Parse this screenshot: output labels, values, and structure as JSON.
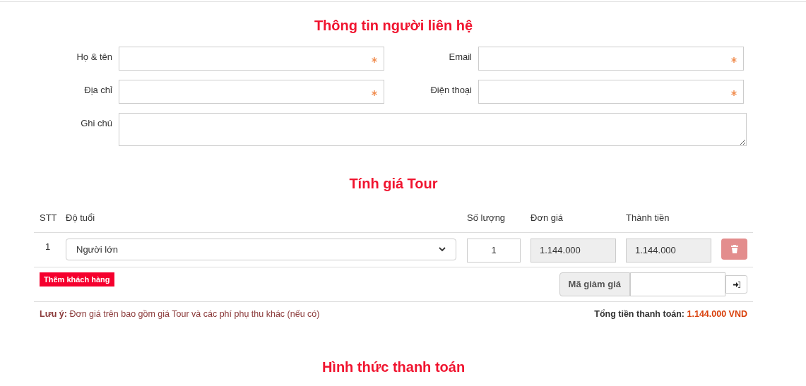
{
  "contact": {
    "title": "Thông tin người liên hệ",
    "fields": [
      {
        "label": "Họ & tên",
        "required": true
      },
      {
        "label": "Email",
        "required": true
      },
      {
        "label": "Địa chỉ",
        "required": true
      },
      {
        "label": "Điện thoại",
        "required": true
      }
    ],
    "note": {
      "label": "Ghi chú"
    }
  },
  "pricing": {
    "title": "Tính giá Tour",
    "columns": [
      "STT",
      "Độ tuổi",
      "Số lượng",
      "Đơn giá",
      "Thành tiền"
    ],
    "rows": [
      {
        "stt": "1",
        "age": "Người lớn",
        "quantity": "1",
        "unit_price": "1.144.000",
        "amount": "1.144.000"
      }
    ],
    "add_button": "Thêm khách hàng",
    "coupon_label": "Mã giảm giá",
    "note_label": "Lưu ý:",
    "note_text": "Đơn giá trên bao gồm giá Tour và các phí phụ thu khác (nếu có)",
    "total_label": "Tổng tiền thanh toán:",
    "total_value": "1.144.000 VND"
  },
  "payment": {
    "title": "Hình thức thanh toán"
  }
}
